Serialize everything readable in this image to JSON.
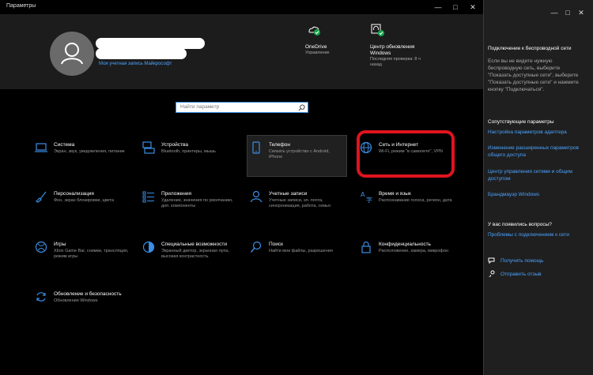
{
  "window": {
    "title": "Параметры"
  },
  "account": {
    "link": "Моя учетная запись Майкрософт"
  },
  "onedrive": {
    "title": "OneDrive",
    "sub": "Управление"
  },
  "update": {
    "title": "Центр обновления Windows",
    "sub": "Последняя проверка: 8 ч назад"
  },
  "search": {
    "placeholder": "Найти параметр"
  },
  "tiles": [
    {
      "title": "Система",
      "desc": "Экран, звук, уведомления, питание",
      "icon": "laptop-icon"
    },
    {
      "title": "Устройства",
      "desc": "Bluetooth, принтеры, мышь",
      "icon": "keyboard-icon"
    },
    {
      "title": "Телефон",
      "desc": "Связать устройство с Android, iPhone",
      "icon": "phone-icon"
    },
    {
      "title": "Сеть и Интернет",
      "desc": "Wi-Fi, режим \"в самолете\", VPN",
      "icon": "globe-icon"
    },
    {
      "title": "Персонализация",
      "desc": "Фон, экран блокировки, цвета",
      "icon": "brush-icon"
    },
    {
      "title": "Приложения",
      "desc": "Удаление, значения по умолчанию, доп. компоненты",
      "icon": "apps-list-icon"
    },
    {
      "title": "Учетные записи",
      "desc": "Учетные записи, эл. почта, синхронизация, работа, семья",
      "icon": "person-icon"
    },
    {
      "title": "Время и язык",
      "desc": "Распознавание голоса, регион, дата",
      "icon": "language-icon"
    },
    {
      "title": "Игры",
      "desc": "Xbox Game Bar, снимки, трансляция, режим игры",
      "icon": "xbox-icon"
    },
    {
      "title": "Специальные возможности",
      "desc": "Экранный диктор, экранная лупа, высокая контрастность",
      "icon": "accessibility-icon"
    },
    {
      "title": "Поиск",
      "desc": "Найти мои файлы, разрешения",
      "icon": "search-icon"
    },
    {
      "title": "Конфиденциальность",
      "desc": "Расположение, камера, микрофон",
      "icon": "lock-icon"
    },
    {
      "title": "Обновление и безопасность",
      "desc": "Обновления Windows",
      "icon": "sync-icon"
    }
  ],
  "right": {
    "title": "Подключение к беспроводной сети",
    "text": "Если вы не видите нужную беспроводную сеть, выберите \"Показать доступные сети\", выберите \"Показать доступные сети\" и нажмите кнопку \"Подключаться\".",
    "related_head": "Сопутствующие параметры",
    "related": [
      "Настройка параметров адаптера",
      "Изменение расширенных параметров общего доступа",
      "Центр управления сетями и общим доступом",
      "Брандмауэр Windows"
    ],
    "q_head": "У вас появились вопросы?",
    "q_link": "Проблемы с подключением к сети",
    "help": "Получить помощь",
    "feedback": "Отправить отзыв"
  },
  "colors": {
    "accent": "#3a8ee6",
    "highlight": "#e0141e"
  }
}
